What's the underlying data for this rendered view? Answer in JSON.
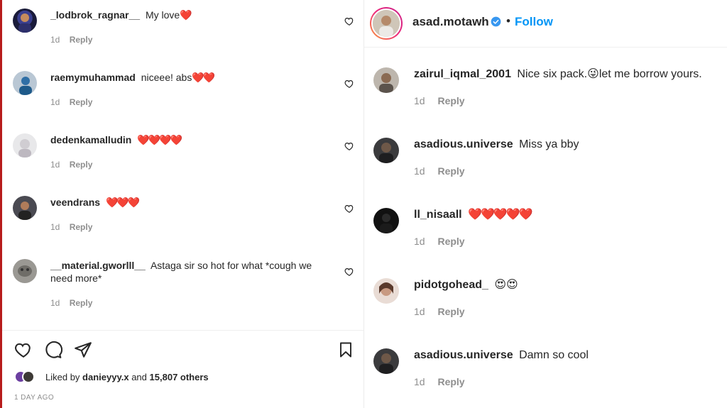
{
  "left_comments": [
    {
      "username": "_lodbrok_ragnar__",
      "text": "My love",
      "emoji": "❤️",
      "time": "1d",
      "reply": "Reply"
    },
    {
      "username": "raemymuhammad",
      "text": "niceee! abs",
      "emoji": "❤️❤️",
      "time": "1d",
      "reply": "Reply"
    },
    {
      "username": "dedenkamalludin",
      "text": "",
      "emoji": "❤️❤️❤️❤️",
      "time": "1d",
      "reply": "Reply"
    },
    {
      "username": "veendrans",
      "text": "",
      "emoji": "❤️❤️❤️",
      "time": "1d",
      "reply": "Reply"
    },
    {
      "username": "__material.gworlll__",
      "text": "Astaga sir so hot for what *cough we need more*",
      "emoji": "",
      "time": "1d",
      "reply": "Reply"
    }
  ],
  "post_footer": {
    "liked_by_prefix": "Liked by",
    "liked_by_user": "danieyyy.x",
    "liked_by_and": "and",
    "liked_by_count": "15,807 others",
    "time_ago": "1 DAY AGO"
  },
  "right_header": {
    "username": "asad.motawh",
    "separator": "•",
    "follow_label": "Follow"
  },
  "right_comments": [
    {
      "username": "zairul_iqmal_2001",
      "text": "Nice six pack.",
      "emoji": "😜",
      "text_after": "let me borrow yours.",
      "time": "1d",
      "reply": "Reply"
    },
    {
      "username": "asadious.universe",
      "text": "Miss ya bby",
      "emoji": "",
      "text_after": "",
      "time": "1d",
      "reply": "Reply"
    },
    {
      "username": "ll_nisaall",
      "text": "",
      "emoji": "❤️❤️❤️❤️❤️",
      "text_after": "",
      "time": "1d",
      "reply": "Reply"
    },
    {
      "username": "pidotgohead_",
      "text": "",
      "emoji": "😍😍",
      "text_after": "",
      "time": "1d",
      "reply": "Reply"
    },
    {
      "username": "asadious.universe",
      "text": "Damn so cool",
      "emoji": "",
      "text_after": "",
      "time": "1d",
      "reply": "Reply"
    }
  ],
  "icons": {
    "like": "heart-outline-icon",
    "comment": "comment-bubble-icon",
    "share": "paper-plane-icon",
    "save": "bookmark-icon",
    "verified": "verified-badge-icon"
  },
  "colors": {
    "accent": "#0095f6",
    "heart": "#e0201e",
    "muted": "#8e8e8e",
    "text": "#262626"
  }
}
